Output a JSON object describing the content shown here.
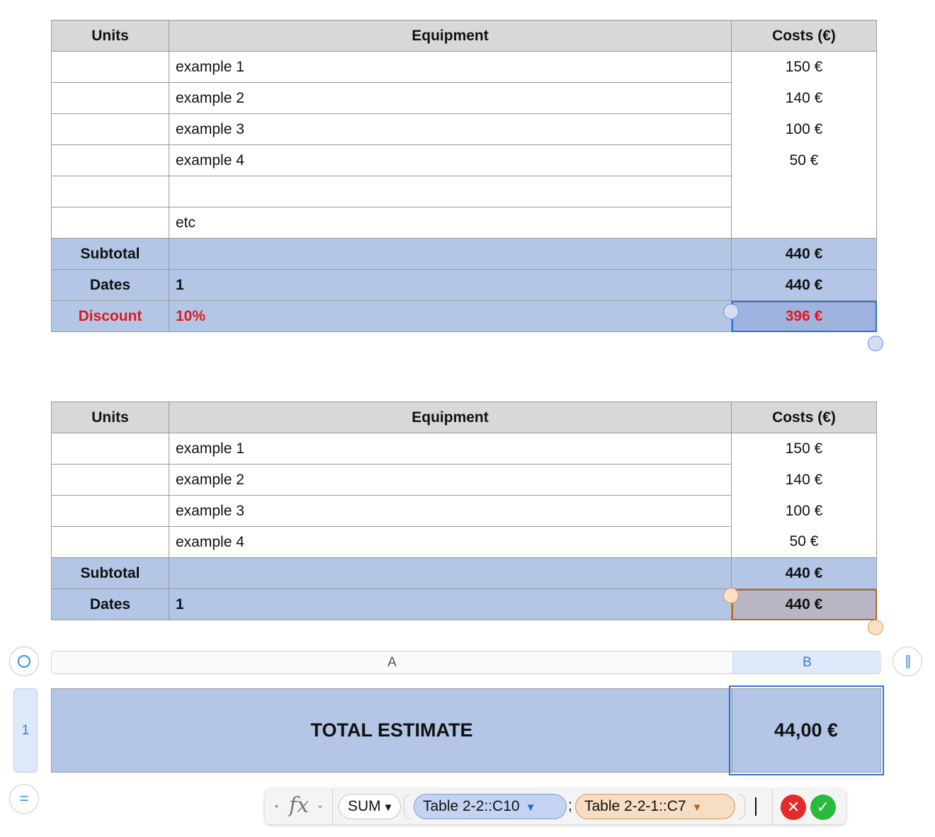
{
  "table1": {
    "headers": [
      "Units",
      "Equipment",
      "Costs (€)"
    ],
    "rows": [
      {
        "units": "",
        "equipment": "example 1",
        "cost": "150 €"
      },
      {
        "units": "",
        "equipment": "example 2",
        "cost": "140 €"
      },
      {
        "units": "",
        "equipment": "example 3",
        "cost": "100 €"
      },
      {
        "units": "",
        "equipment": "example 4",
        "cost": "50 €"
      },
      {
        "units": "",
        "equipment": "",
        "cost": ""
      },
      {
        "units": "",
        "equipment": "etc",
        "cost": ""
      }
    ],
    "subtotal": {
      "label": "Subtotal",
      "mid": "",
      "cost": "440 €"
    },
    "dates": {
      "label": "Dates",
      "mid": "1",
      "cost": "440 €"
    },
    "discount": {
      "label": "Discount",
      "mid": "10%",
      "cost": "396 €"
    }
  },
  "table2": {
    "headers": [
      "Units",
      "Equipment",
      "Costs (€)"
    ],
    "rows": [
      {
        "units": "",
        "equipment": "example 1",
        "cost": "150 €"
      },
      {
        "units": "",
        "equipment": "example 2",
        "cost": "140 €"
      },
      {
        "units": "",
        "equipment": "example 3",
        "cost": "100 €"
      },
      {
        "units": "",
        "equipment": "example 4",
        "cost": "50 €"
      }
    ],
    "subtotal": {
      "label": "Subtotal",
      "mid": "",
      "cost": "440 €"
    },
    "dates": {
      "label": "Dates",
      "mid": "1",
      "cost": "440 €"
    }
  },
  "total_table": {
    "column_a": "A",
    "column_b": "B",
    "row_number": "1",
    "label": "TOTAL ESTIMATE",
    "value": "44,00 €"
  },
  "formula_bar": {
    "fx_label": "fx",
    "function": "SUM",
    "ref1": "Table 2-2::C10",
    "separator": ";",
    "ref2": "Table 2-2-1::C7",
    "cancel_icon": "close-icon",
    "accept_icon": "checkmark-icon"
  },
  "colors": {
    "header_gray": "#d8d8d8",
    "row_blue": "#b3c6e6",
    "discount_red": "#e0191f",
    "selection_blue": "#2f6fd6",
    "selection_orange": "#b5651d"
  }
}
